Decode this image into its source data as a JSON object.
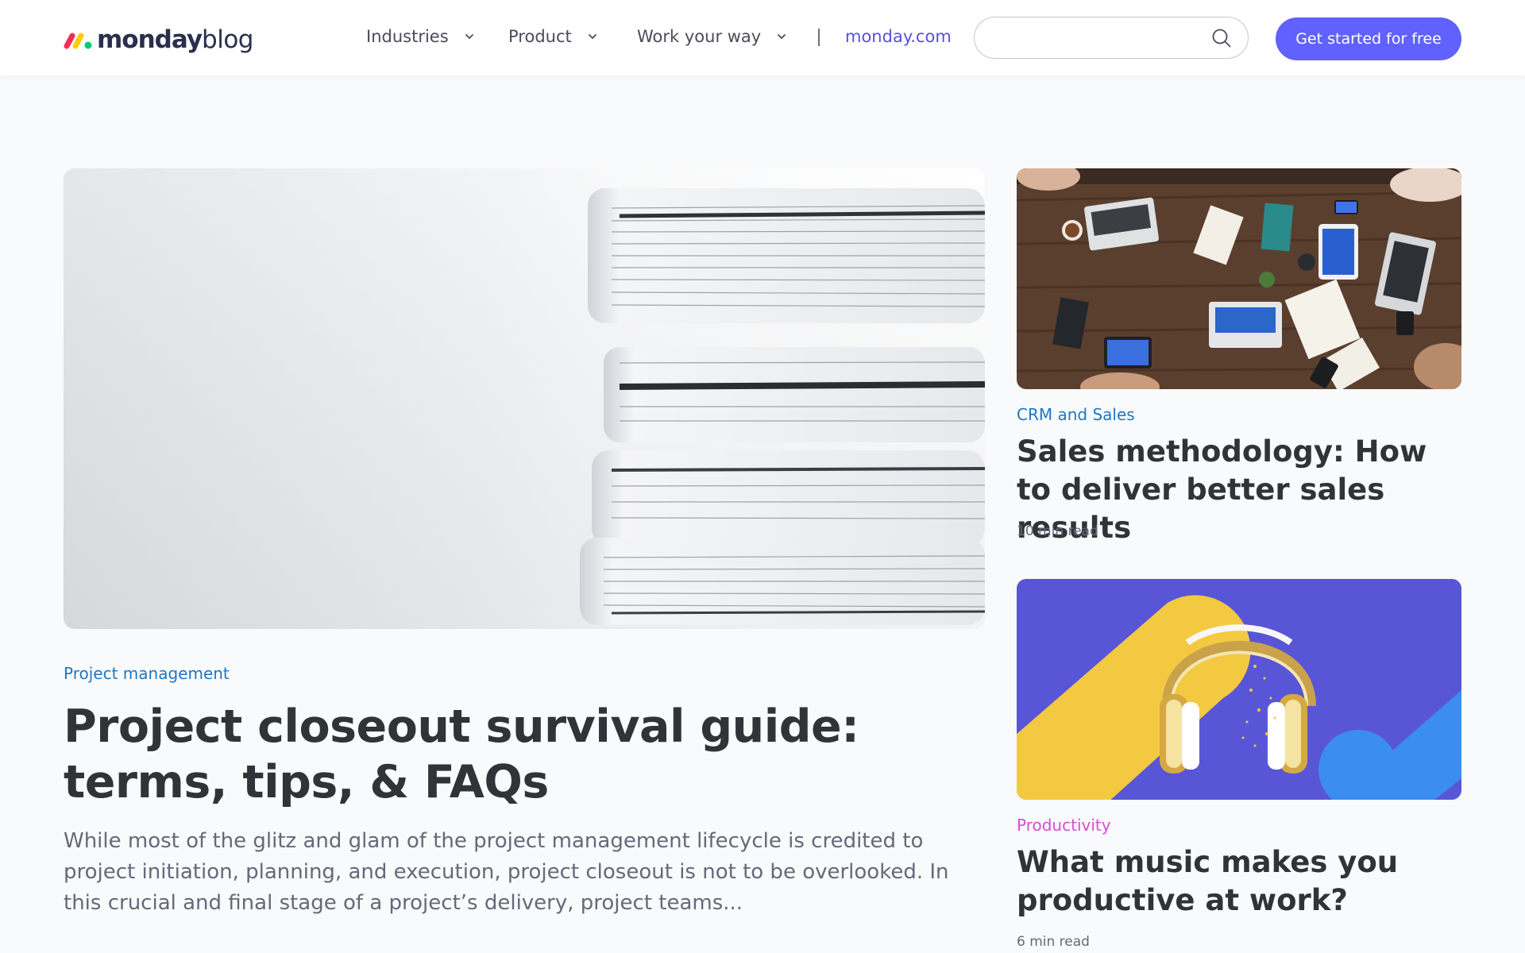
{
  "header": {
    "logo": {
      "brand": "monday",
      "suffix": "blog"
    },
    "nav": [
      {
        "label": "Industries"
      },
      {
        "label": "Product"
      },
      {
        "label": "Work your way"
      }
    ],
    "site_link": "monday.com",
    "search": {
      "placeholder": "",
      "value": ""
    },
    "cta_label": "Get started for free"
  },
  "featured": {
    "image": "stacked-binders-photo",
    "category": "Project management",
    "category_color": "#1f76c2",
    "title": "Project closeout survival guide: terms, tips, & FAQs",
    "excerpt": "While most of the glitz and glam of the project management lifecycle is credited to project initiation, planning, and execution, project closeout is not to be overlooked. In this crucial and final stage of a project’s delivery, project teams..."
  },
  "cards": [
    {
      "image": "team-meeting-table-photo",
      "category": "CRM and Sales",
      "category_color": "#1f76c2",
      "title": "Sales methodology: How to deliver better sales results",
      "read_time": "10 min read"
    },
    {
      "image": "headphones-illustration",
      "category": "Productivity",
      "category_color": "#d84dd1",
      "title": "What music makes you productive at work?",
      "read_time": "6 min read"
    }
  ],
  "colors": {
    "accent": "#6161ff",
    "text": "#323338",
    "muted": "#676879",
    "background": "#f9fafc"
  }
}
